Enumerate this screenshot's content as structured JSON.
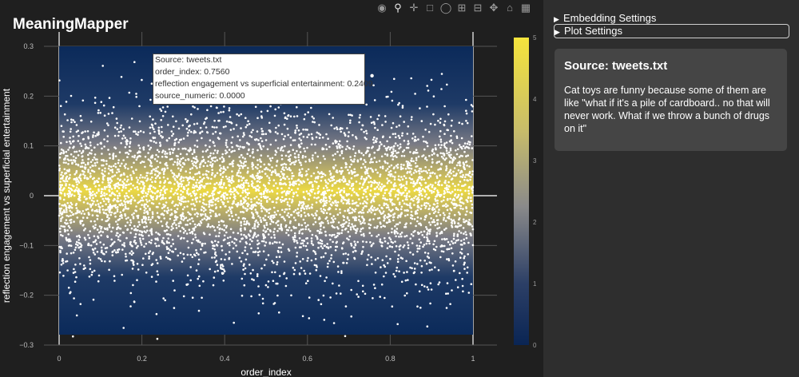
{
  "app": {
    "title": "MeaningMapper"
  },
  "toolbar": {
    "icons": [
      "camera-icon",
      "zoom-icon",
      "pan-icon",
      "box-select-icon",
      "lasso-select-icon",
      "zoom-in-icon",
      "zoom-out-icon",
      "autoscale-icon",
      "reset-axes-icon",
      "plotly-logo-icon"
    ]
  },
  "chart_data": {
    "type": "scatter",
    "xlabel": "order_index",
    "ylabel": "reflection engagement vs superficial entertainment",
    "xlim": [
      0,
      1
    ],
    "ylim": [
      -0.3,
      0.3
    ],
    "x_ticks": [
      "0",
      "0.2",
      "0.4",
      "0.6",
      "0.8",
      "1"
    ],
    "y_ticks": [
      "0.3",
      "0.2",
      "0.1",
      "0",
      "−0.1",
      "−0.2",
      "−0.3"
    ],
    "point_color": "#ffffff",
    "density_colorscale": [
      "#0b2a5a",
      "#6e7587",
      "#b8b078",
      "#f2e03a"
    ],
    "colorbar": {
      "range": [
        0,
        5
      ],
      "ticks": [
        "5",
        "4",
        "3",
        "2",
        "1",
        "0"
      ]
    },
    "point_count_estimate": 5000,
    "y_spread_sd": 0.085,
    "hovered_point": {
      "source": "tweets.txt",
      "order_index": 0.756,
      "reflection_engagement_vs_superficial_entertainment": 0.2409,
      "source_numeric": 0.0
    }
  },
  "hover": {
    "line1": "Source: tweets.txt",
    "line2": "order_index: 0.7560",
    "line3": "reflection engagement vs superficial entertainment: 0.2409",
    "line4": "source_numeric: 0.0000"
  },
  "sidebar": {
    "embedding_settings": "Embedding Settings",
    "plot_settings": "Plot Settings",
    "card": {
      "title": "Source: tweets.txt",
      "text": "Cat toys are funny because some of them are like \"what if it's a pile of cardboard.. no that will never work. What if we throw a bunch of drugs on it\""
    }
  }
}
